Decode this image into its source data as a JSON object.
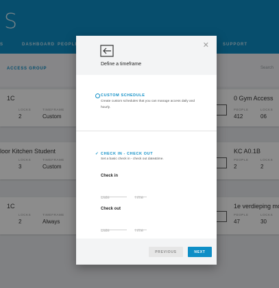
{
  "app": {
    "brand": "S",
    "nav": [
      "S",
      "DASHBOARD",
      "PEOPLE",
      "SUPPORT"
    ],
    "toolbar": {
      "label": "ACCESS GROUP",
      "search": "Search"
    }
  },
  "cards": [
    {
      "title": "1C",
      "labels": [
        "LOCKS",
        "TIMEFRAME"
      ],
      "values": [
        "2",
        "Custom"
      ]
    },
    {
      "title": "loor Kitchen Student",
      "labels": [
        "LOCKS",
        "TIMEFRAME"
      ],
      "values": [
        "3",
        "Custom"
      ]
    },
    {
      "title": "1C",
      "labels": [
        "LOCKS",
        "TIMEFRAME"
      ],
      "values": [
        "2",
        "Always"
      ]
    },
    {
      "title": "0 Gym Access",
      "labels": [
        "PEOPLE",
        "LOCKS"
      ],
      "values": [
        "412",
        "06"
      ]
    },
    {
      "title": "KC A0.1B",
      "labels": [
        "PEOPLE",
        "LOCKS"
      ],
      "values": [
        "2",
        "2"
      ]
    },
    {
      "title": "1e verdieping mor",
      "labels": [
        "PEOPLE",
        "LOCKS"
      ],
      "values": [
        "47",
        "30"
      ]
    }
  ],
  "modal": {
    "title": "Define a timeframe",
    "custom": {
      "title": "CUSTOM SCHEDULE",
      "desc": "Create custom schedules that you can manage access daily and hourly."
    },
    "checkin": {
      "check_mark": "✓",
      "title": "CHECK IN - CHECK OUT",
      "desc": "Set a basic check in - check out date&time.",
      "in_label": "Check in",
      "out_label": "Check out",
      "date_placeholder": "Date",
      "time_placeholder": "Time"
    },
    "previous": "PREVIOUS",
    "next": "NEXT"
  },
  "colors": {
    "accent": "#0e8ec6"
  },
  "icons": {
    "header": "door-exit-icon",
    "close": "close-icon",
    "card": "door-exit-icon"
  }
}
